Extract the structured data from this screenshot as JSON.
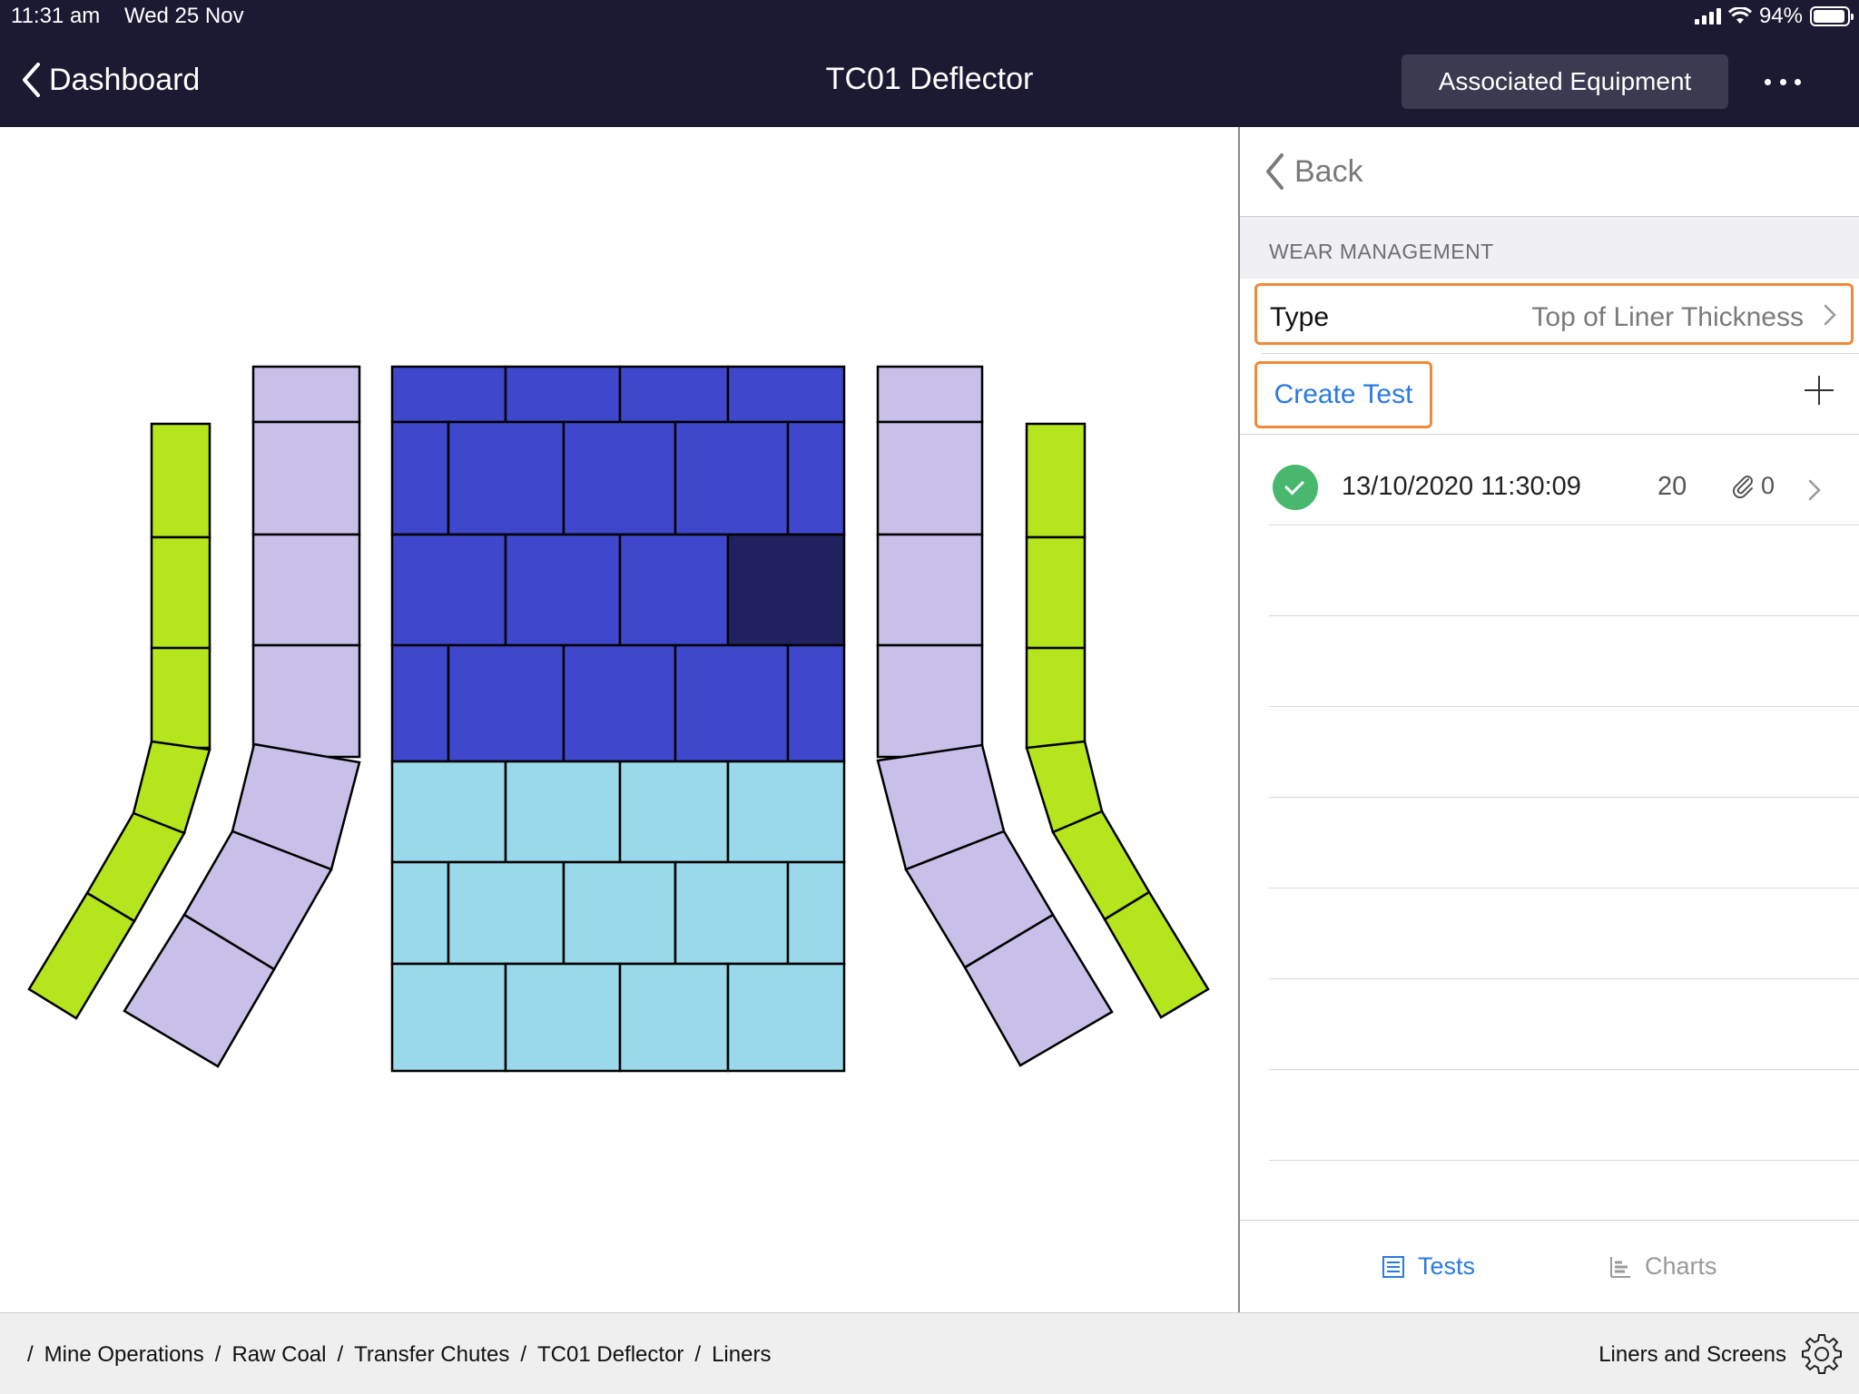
{
  "status_bar": {
    "time": "11:31 am",
    "date": "Wed 25 Nov",
    "battery": "94%"
  },
  "nav": {
    "back_label": "Dashboard",
    "title": "TC01 Deflector",
    "associated_label": "Associated Equipment"
  },
  "panel": {
    "back_label": "Back",
    "section_label": "WEAR MANAGEMENT",
    "type_label": "Type",
    "type_value": "Top of Liner Thickness",
    "create_label": "Create Test",
    "tests": [
      {
        "date": "13/10/2020 11:30:09",
        "count": "20",
        "attachments": "0",
        "status": "complete"
      }
    ]
  },
  "tabs": {
    "tests_label": "Tests",
    "charts_label": "Charts",
    "active": "Tests"
  },
  "breadcrumb": [
    "Mine Operations",
    "Raw Coal",
    "Transfer Chutes",
    "TC01 Deflector",
    "Liners"
  ],
  "bottom_right_label": "Liners and Screens",
  "colors": {
    "header_bg": "#1c1a33",
    "accent_blue": "#2a7ae2",
    "highlight_orange": "#f08a3a",
    "liner_green": "#b5e61d",
    "liner_lavender": "#c8c0e8",
    "liner_blue": "#3f48cc",
    "liner_dark_blue": "#20215f",
    "liner_light_blue": "#99d9ea"
  },
  "icons": [
    "chevron-left-icon",
    "more-icon",
    "plus-icon",
    "check-icon",
    "paperclip-icon",
    "list-icon",
    "chart-icon",
    "gear-icon",
    "signal-icon",
    "wifi-icon",
    "battery-icon"
  ]
}
